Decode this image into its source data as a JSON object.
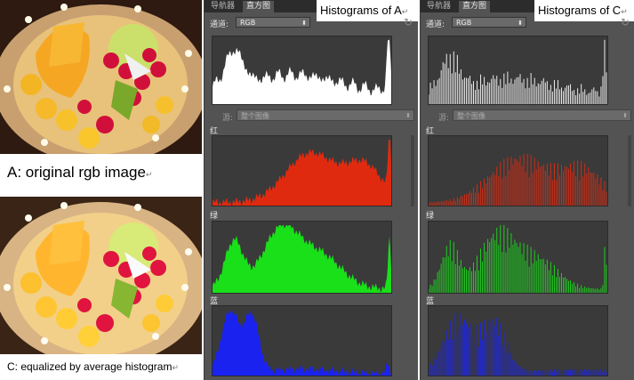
{
  "left": {
    "caption_a": "A: original rgb image",
    "caption_c": "C: equalized by average histogram",
    "return_mark": "↵"
  },
  "panels": [
    {
      "id": "a",
      "title": "Histograms of A",
      "tabs": [
        "导航器",
        "直方图"
      ],
      "channel_label": "通道:",
      "channel_value": "RGB",
      "source_label": "源:",
      "source_value": "整个图像",
      "labels": {
        "red": "红",
        "green": "绿",
        "blue": "蓝"
      }
    },
    {
      "id": "c",
      "title": "Histograms of C",
      "tabs": [
        "导航器",
        "直方图"
      ],
      "channel_label": "通道:",
      "channel_value": "RGB",
      "source_label": "源:",
      "source_value": "整个图像",
      "labels": {
        "red": "红",
        "green": "绿",
        "blue": "蓝"
      }
    }
  ],
  "colors": {
    "panel_bg": "#535353",
    "hist_bg": "#3a3a3a",
    "rgb": "#ffffff",
    "red": "#e02a10",
    "green": "#19e019",
    "blue": "#1a22f0"
  },
  "icons": [
    "refresh-icon",
    "dropdown-arrow-icon"
  ]
}
